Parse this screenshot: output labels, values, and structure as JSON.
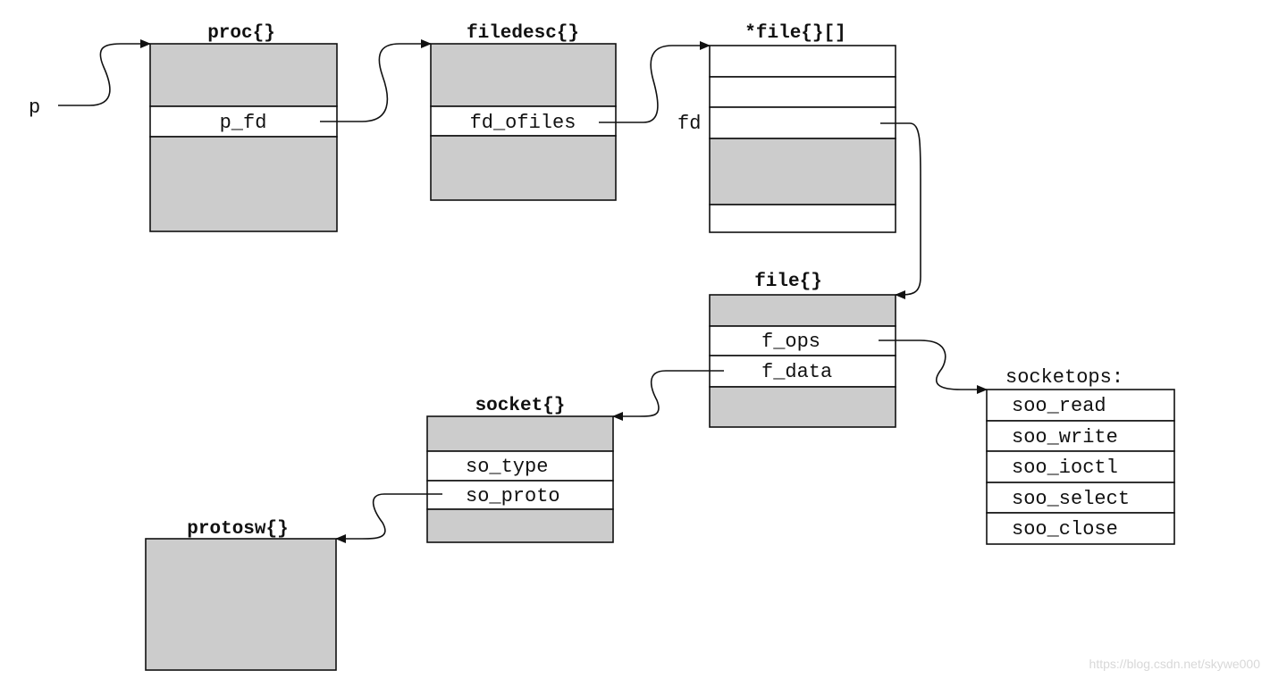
{
  "pointer_label": "p",
  "fd_label": "fd",
  "structs": {
    "proc": {
      "title": "proc{}",
      "fields": [
        "p_fd"
      ]
    },
    "filedesc": {
      "title": "filedesc{}",
      "fields": [
        "fd_ofiles"
      ]
    },
    "file_array": {
      "title": "*file{}[]"
    },
    "file": {
      "title": "file{}",
      "fields": [
        "f_ops",
        "f_data"
      ]
    },
    "socket": {
      "title": "socket{}",
      "fields": [
        "so_type",
        "so_proto"
      ]
    },
    "protosw": {
      "title": "protosw{}"
    },
    "socketops": {
      "title": "socketops:",
      "fields": [
        "soo_read",
        "soo_write",
        "soo_ioctl",
        "soo_select",
        "soo_close"
      ]
    }
  },
  "colors": {
    "shaded": "#cccccc",
    "line": "#111111"
  },
  "watermark": "https://blog.csdn.net/skywe000"
}
